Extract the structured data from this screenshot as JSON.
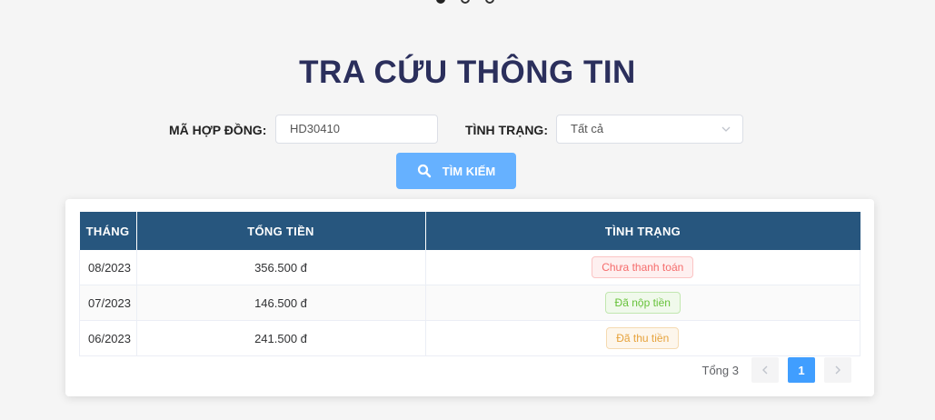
{
  "carousel": {
    "dot_count": 3,
    "active_index": 0
  },
  "page": {
    "title": "TRA CỨU THÔNG TIN"
  },
  "form": {
    "contract_label": "MÃ HỢP ĐỒNG:",
    "contract_value": "HD30410",
    "status_label": "TÌNH TRẠNG:",
    "status_value": "Tất cả",
    "search_button": "TÌM KIẾM"
  },
  "table": {
    "headers": {
      "month": "THÁNG",
      "total": "TỔNG TIỀN",
      "status": "TÌNH TRẠNG"
    },
    "rows": [
      {
        "month": "08/2023",
        "total": "356.500 đ",
        "status": "Chưa thanh toán",
        "status_type": "unpaid"
      },
      {
        "month": "07/2023",
        "total": "146.500 đ",
        "status": "Đã nộp tiền",
        "status_type": "paid"
      },
      {
        "month": "06/2023",
        "total": "241.500 đ",
        "status": "Đã thu tiền",
        "status_type": "collected"
      }
    ]
  },
  "pagination": {
    "total_label": "Tổng 3",
    "current_page": "1"
  },
  "colors": {
    "title": "#2b2f5c",
    "header_bg": "#27567e",
    "button_bg": "#66b1ff",
    "active_page": "#409eff"
  }
}
